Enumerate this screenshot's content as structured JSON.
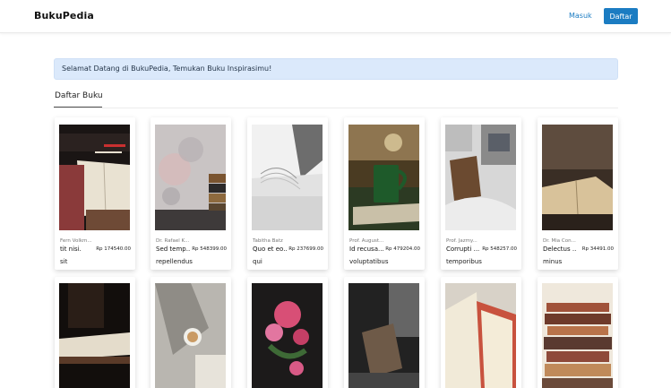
{
  "navbar": {
    "brand": "BukuPedia",
    "login_label": "Masuk",
    "register_label": "Daftar"
  },
  "alert": {
    "message": "Selamat Datang di BukuPedia, Temukan Buku Inspirasimu!"
  },
  "section": {
    "title": "Daftar Buku"
  },
  "books": [
    {
      "author": "Fern Volkm...",
      "title": "tit nisi.",
      "price": "Rp 174540.00",
      "tag": "sit"
    },
    {
      "author": "Dr. Rafael K...",
      "title": "Sed temp...",
      "price": "Rp 548399.00",
      "tag": "repellendus"
    },
    {
      "author": "Tabitha Batz",
      "title": "Quo et eo...",
      "price": "Rp 237699.00",
      "tag": "qui"
    },
    {
      "author": "Prof. August...",
      "title": "Id recusa...",
      "price": "Rp 479204.00",
      "tag": "voluptatibus"
    },
    {
      "author": "Prof. Jazmy...",
      "title": "Corrupti ...",
      "price": "Rp 548257.00",
      "tag": "temporibus"
    },
    {
      "author": "Dr. Mia Con...",
      "title": "Delectus ...",
      "price": "Rp 34491.00",
      "tag": "minus"
    }
  ],
  "colors": {
    "accent": "#1b7cc2",
    "alert_bg": "#dbe9fb"
  }
}
